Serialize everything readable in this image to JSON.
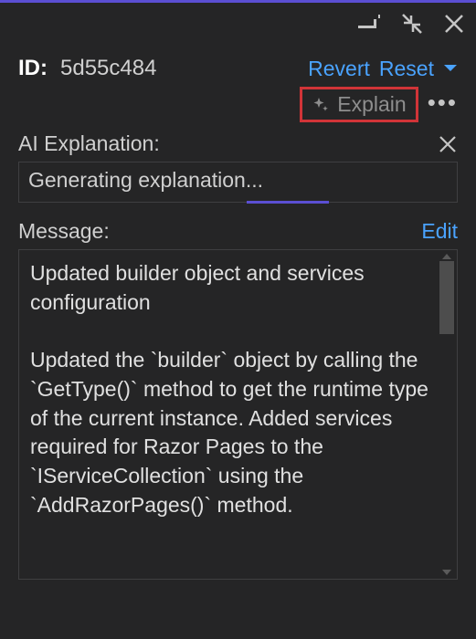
{
  "header": {
    "id_label": "ID:",
    "id_value": "5d55c484",
    "revert": "Revert",
    "reset": "Reset"
  },
  "explain": {
    "label": "Explain"
  },
  "ai": {
    "section_label": "AI Explanation:",
    "status": "Generating explanation..."
  },
  "message": {
    "label": "Message:",
    "edit": "Edit",
    "body": "Updated builder object and services configuration\n\nUpdated the `builder` object by calling the `GetType()` method to get the runtime type of the current instance. Added services required for Razor Pages to the `IServiceCollection` using the `AddRazorPages()` method."
  }
}
